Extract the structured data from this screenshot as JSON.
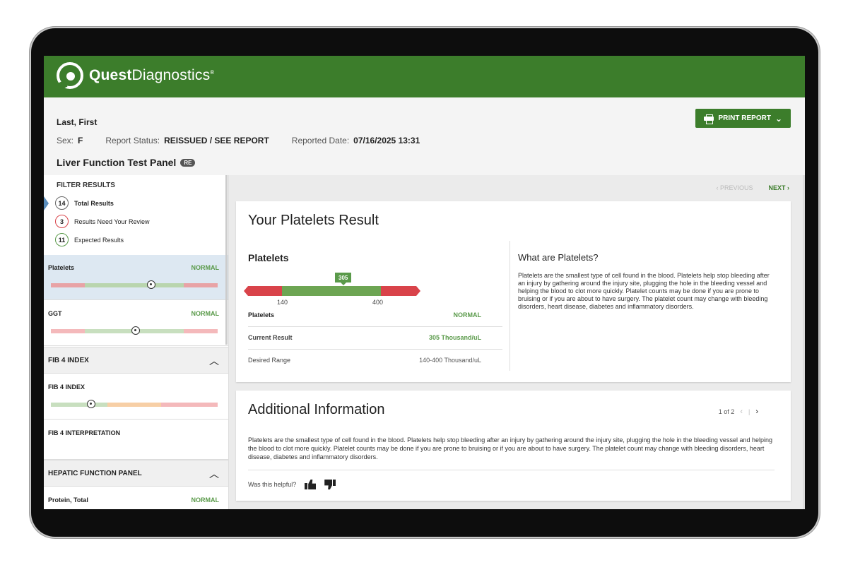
{
  "brand": {
    "name_bold": "Quest",
    "name_light": "Diagnostics",
    "mark": "®"
  },
  "header": {
    "patient_name": "Last, First",
    "sex_label": "Sex:",
    "sex_value": "F",
    "status_label": "Report Status:",
    "status_value": "REISSUED / SEE REPORT",
    "date_label": "Reported Date:",
    "date_value": "07/16/2025 13:31",
    "panel_title": "Liver Function Test Panel",
    "panel_badge": "RE",
    "print_label": "PRINT REPORT"
  },
  "sidebar": {
    "filter_title": "FILTER RESULTS",
    "filters": [
      {
        "count": "14",
        "label": "Total Results"
      },
      {
        "count": "3",
        "label": "Results Need Your Review"
      },
      {
        "count": "11",
        "label": "Expected Results"
      }
    ],
    "results": [
      {
        "name": "Platelets",
        "status": "NORMAL",
        "marker_fraction": 0.6
      },
      {
        "name": "GGT",
        "status": "NORMAL",
        "marker_fraction": 0.51
      }
    ],
    "section_fib": "FIB 4 INDEX",
    "fib_item": "FIB 4 INDEX",
    "fib_marker_fraction": 0.24,
    "fib_interp": "FIB 4 INTERPRETATION",
    "section_hepatic": "HEPATIC FUNCTION PANEL",
    "hepatic_item": {
      "name": "Protein, Total",
      "status": "NORMAL"
    }
  },
  "pager": {
    "previous": "PREVIOUS",
    "next": "NEXT"
  },
  "result_card": {
    "title": "Your Platelets Result",
    "test_name": "Platelets",
    "value_flag": "305",
    "range_low": "140",
    "range_high": "400",
    "rows": [
      {
        "k": "Platelets",
        "v": "NORMAL"
      },
      {
        "k": "Current Result",
        "v": "305 Thousand/uL"
      },
      {
        "k": "Desired Range",
        "v": "140-400 Thousand/uL"
      }
    ],
    "what_title": "What are Platelets?",
    "what_body": "Platelets are the smallest type of cell found in the blood. Platelets help stop bleeding after an injury by gathering around the injury site, plugging the hole in the bleeding vessel and helping the blood to clot more quickly. Platelet counts may be done if you are prone to bruising or if you are about to have surgery. The platelet count may change with bleeding disorders, heart disease, diabetes and inflammatory disorders."
  },
  "additional": {
    "title": "Additional Information",
    "page": "1 of 2",
    "body": "Platelets are the smallest type of cell found in the blood. Platelets help stop bleeding after an injury by gathering around the injury site, plugging the hole in the bleeding vessel and helping the blood to clot more quickly. Platelet counts may be done if you are prone to bruising or if you are about to have surgery. The platelet count may change with bleeding disorders, heart disease, diabetes and inflammatory disorders.",
    "helpful": "Was this helpful?"
  },
  "colors": {
    "brand_green": "#3c7d2b",
    "normal_green": "#5a9a4a",
    "alert_red": "#d9434a",
    "active_blue": "#dde8f2"
  }
}
